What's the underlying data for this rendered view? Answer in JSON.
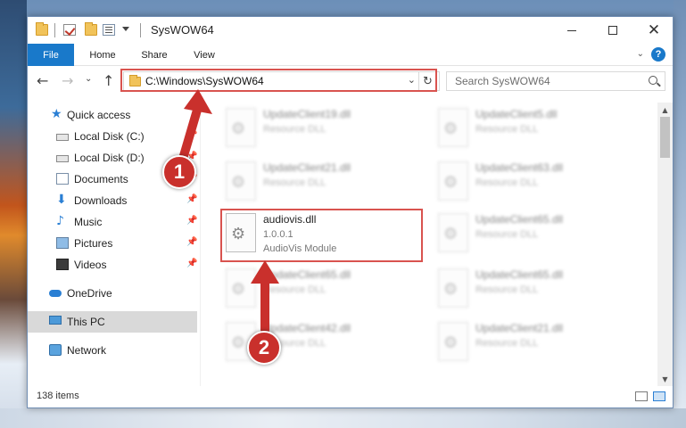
{
  "window": {
    "title": "SysWOW64"
  },
  "ribbon": {
    "tabs": [
      "File",
      "Home",
      "Share",
      "View"
    ],
    "help": "?"
  },
  "nav": {
    "address": "C:\\Windows\\SysWOW64",
    "search_placeholder": "Search SysWOW64"
  },
  "sidebar": {
    "items": [
      {
        "label": "Quick access",
        "icon": "star-icon"
      },
      {
        "label": "Local Disk (C:)",
        "icon": "disk-icon",
        "pinned": true
      },
      {
        "label": "Local Disk (D:)",
        "icon": "disk-icon",
        "pinned": true
      },
      {
        "label": "Documents",
        "icon": "documents-icon",
        "pinned": true
      },
      {
        "label": "Downloads",
        "icon": "downloads-icon",
        "pinned": true
      },
      {
        "label": "Music",
        "icon": "music-icon",
        "pinned": true
      },
      {
        "label": "Pictures",
        "icon": "pictures-icon",
        "pinned": true
      },
      {
        "label": "Videos",
        "icon": "videos-icon",
        "pinned": true
      },
      {
        "label": "OneDrive",
        "icon": "onedrive-icon"
      },
      {
        "label": "This PC",
        "icon": "this-pc-icon",
        "selected": true
      },
      {
        "label": "Network",
        "icon": "network-icon"
      }
    ]
  },
  "files": {
    "left_column": [
      {
        "name": "UpdateClient19.dll",
        "desc": "Resource DLL"
      },
      {
        "name": "UpdateClient21.dll",
        "desc": "Resource DLL"
      },
      {
        "name": "audiovis.dll",
        "version": "1.0.0.1",
        "desc": "AudioVis Module"
      },
      {
        "name": "UpdateClient65.dll",
        "desc": "Resource DLL"
      },
      {
        "name": "UpdateClient42.dll",
        "desc": "Resource DLL"
      }
    ],
    "right_column": [
      {
        "name": "UpdateClient5.dll",
        "desc": "Resource DLL"
      },
      {
        "name": "UpdateClient63.dll",
        "desc": "Resource DLL"
      },
      {
        "name": "UpdateClient65.dll",
        "desc": "Resource DLL"
      },
      {
        "name": "UpdateClient65.dll",
        "desc": "Resource DLL"
      },
      {
        "name": "UpdateClient21.dll",
        "desc": "Resource DLL"
      }
    ]
  },
  "status": {
    "item_count": "138 items"
  },
  "annotations": {
    "step1": "1",
    "step2": "2",
    "color": "#c9302c"
  }
}
